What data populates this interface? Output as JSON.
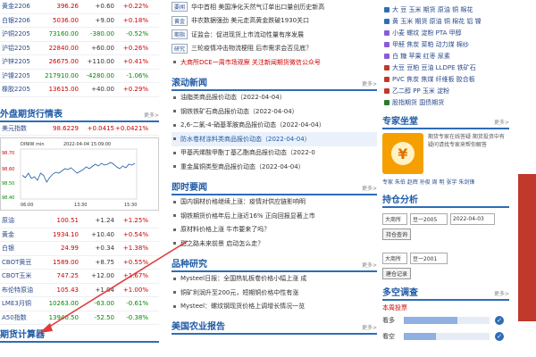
{
  "colors": {
    "accent": "#1f5aa6",
    "up": "#cc0000",
    "down": "#008800",
    "arrow": "#e03a3a",
    "promo": "#f5a000"
  },
  "left": {
    "domestic_rows": [
      {
        "name": "黄金2206",
        "last": "396.26",
        "chg": "+0.60",
        "pct": "+0.22%"
      },
      {
        "name": "白银2206",
        "last": "5036.00",
        "chg": "+9.00",
        "pct": "+0.18%"
      },
      {
        "name": "沪铜2205",
        "last": "73160.00",
        "chg": "-380.00",
        "pct": "-0.52%"
      },
      {
        "name": "沪铝2205",
        "last": "22840.00",
        "chg": "+60.00",
        "pct": "+0.26%"
      },
      {
        "name": "沪锌2205",
        "last": "26675.00",
        "chg": "+110.00",
        "pct": "+0.41%"
      },
      {
        "name": "沪镍2205",
        "last": "217910.00",
        "chg": "-4280.00",
        "pct": "-1.06%"
      },
      {
        "name": "橡胶2205",
        "last": "13615.00",
        "chg": "+40.00",
        "pct": "+0.29%"
      }
    ],
    "foreign_title": "外盘期货行情表",
    "foreign_more": "更多>",
    "usd_index": {
      "name": "美元指数",
      "last": "98.6229",
      "chg": "+0.0415",
      "pct": "+0.0421%"
    },
    "chart": {
      "label": "DINIW min",
      "time": "2022-04-04 15:09:00",
      "y_ticks": [
        "98.70",
        "98.60",
        "98.50",
        "98.40"
      ],
      "x_ticks": [
        "06:00",
        "13:30",
        "15:30"
      ]
    },
    "foreign_rows": [
      {
        "name": "原油",
        "last": "100.51",
        "chg": "+1.24",
        "pct": "+1.25%"
      },
      {
        "name": "黄金",
        "last": "1934.10",
        "chg": "+10.40",
        "pct": "+0.54%"
      },
      {
        "name": "白银",
        "last": "24.99",
        "chg": "+0.34",
        "pct": "+1.38%"
      },
      {
        "name": "CBOT黄豆",
        "last": "1589.00",
        "chg": "+8.75",
        "pct": "+0.55%"
      },
      {
        "name": "CBOT玉米",
        "last": "747.25",
        "chg": "+12.00",
        "pct": "+1.67%"
      },
      {
        "name": "布伦特原油",
        "last": "105.43",
        "chg": "+1.04",
        "pct": "+1.00%"
      },
      {
        "name": "LME3月铜",
        "last": "10263.00",
        "chg": "-63.00",
        "pct": "-0.61%"
      },
      {
        "name": "A50指数",
        "last": "13940.50",
        "chg": "-52.50",
        "pct": "-0.38%"
      }
    ],
    "footer_title": "期货计算器"
  },
  "mid": {
    "top_news": [
      {
        "tag": "要闻",
        "text": "华中首相 美国净化天然气订单出口量创历史新高"
      },
      {
        "tag": "黄金",
        "text": "非农数据强劲 美元走高黄金跌破1930关口"
      },
      {
        "tag": "期指",
        "text": "证监会：促进现货上市流动性量有序发展"
      },
      {
        "tag": "研究",
        "text": "三轮疫情冲击物流梗阻 后市需求会否见底？"
      }
    ],
    "top_red": "大商所DCE一周市场观察 关注新闻期货微信公众号",
    "sections": [
      {
        "title": "滚动新闻",
        "more": "更多>",
        "items": [
          "油脂类商品报价动态（2022-04-04）",
          "钢铁铁矿石商品报价动态（2022-04-04）",
          "2,6-二氯-4-硝基苯胺商品报价动态（2022-04-04）",
          "防水卷材涂料类商品报价动态（2022-04-04）",
          "甲基丙烯酸甲酯丁基乙酯商品报价动态（2022-0",
          "重金属铜类型商品报价动态（2022-04-04）"
        ]
      },
      {
        "title": "即时要闻",
        "more": "更多>",
        "items": [
          "国内钢材价格继续上涨：疫情对供应链影响明",
          "钢铁期货价格年后上涨近16% 正向回报显著上市",
          "原材料价格上涨 牛市要来了吗？",
          "甜之路未来前景 启动怎么走？"
        ]
      },
      {
        "title": "品种研究",
        "more": "更多>",
        "items": [
          "Mysteel日报：全国热轧板卷价格小幅上涨 成",
          "铜矿利润升至200元，短期铜价格中性有涨",
          "Mysteel：螺纹钢现货价格上调增长情况一览"
        ]
      },
      {
        "title": "美国农业报告",
        "more": "更多>",
        "items": []
      }
    ]
  },
  "right": {
    "top_lines": [
      {
        "color": "#2f6db5",
        "text": "大 豆 玉米 期货 原油 铜 棉花"
      },
      {
        "color": "#2f6db5",
        "text": "黄 玉米 期货 原油 铜 棉花 铝 镍"
      },
      {
        "color": "#8a5bd6",
        "text": "小麦 螺纹 淀粉 PTA 甲醇"
      },
      {
        "color": "#8a5bd6",
        "text": "甲醛 焦炭 菜粕 动力煤 棉纱"
      },
      {
        "color": "#8a5bd6",
        "text": "白 糖 苹果 红枣 尿素"
      },
      {
        "color": "#c0392b",
        "text": "大豆 豆粕 豆油 LLDPE 铁矿石"
      },
      {
        "color": "#c0392b",
        "text": "PVC 焦炭 焦煤 纤维板 胶合板"
      },
      {
        "color": "#c0392b",
        "text": "乙二醇 PP 玉米 淀粉"
      },
      {
        "color": "#2a7a2a",
        "text": "股指期货 国债期货"
      }
    ],
    "expert_title": "专家坐堂",
    "expert_more": "更多>",
    "expert_desc": "期货专家在线答疑 期货投资中有疑问请找专家来帮你解答",
    "expert_links": "专家 朱伯 赵辉 孙俊 周 明 张宇 朱剑锋",
    "tools_title": "持仓分析",
    "sel1": [
      "大商所",
      "豆一2005",
      "2022-04-03"
    ],
    "btn1": "持仓查询",
    "sel2": [
      "大商所",
      "豆一2001"
    ],
    "btn2": "建仓记录",
    "survey_title": "多空调查",
    "survey_more": "更多>",
    "survey_sub": "本周投票",
    "survey_rows": [
      {
        "label": "看多",
        "value": 0.62
      },
      {
        "label": "看空",
        "value": 0.38
      }
    ]
  }
}
